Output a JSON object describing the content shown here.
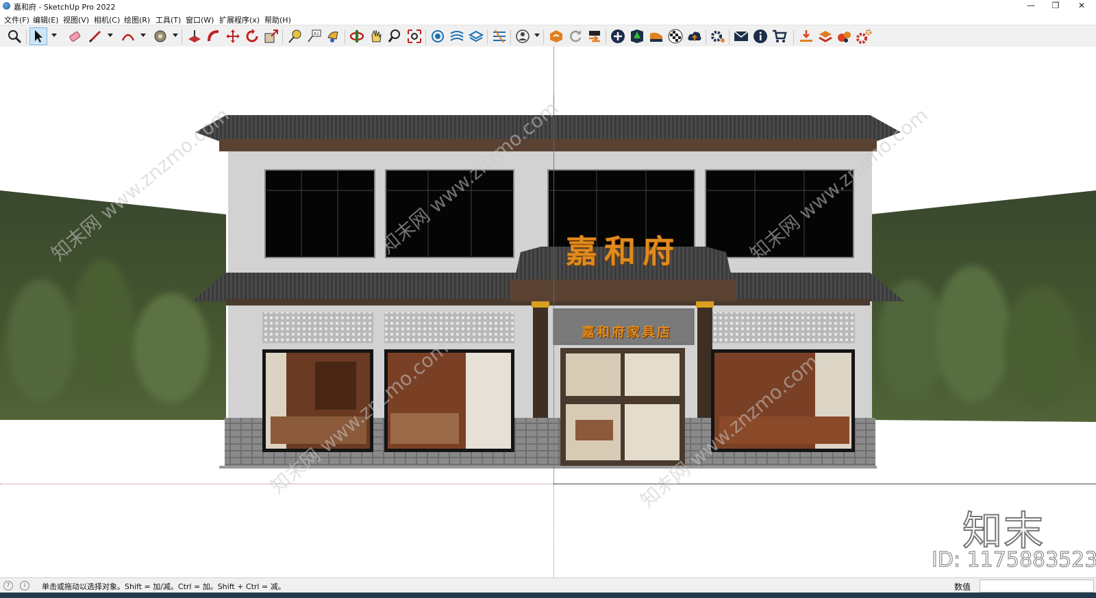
{
  "window": {
    "title": "嘉和府 - SketchUp Pro 2022",
    "controls": {
      "minimize": "—",
      "restore": "❐",
      "close": "✕"
    }
  },
  "menu": [
    "文件(F)",
    "编辑(E)",
    "视图(V)",
    "相机(C)",
    "绘图(R)",
    "工具(T)",
    "窗口(W)",
    "扩展程序(x)",
    "帮助(H)"
  ],
  "toolbar": {
    "tools": [
      "zoom-icon",
      "select-arrow-icon",
      "eraser-icon",
      "pencil-line-icon",
      "arc-icon",
      "paint-bucket-icon",
      "push-pull-icon",
      "follow-me-icon",
      "move-icon",
      "rotate-icon",
      "scale-icon",
      "tape-measure-icon",
      "text-label-icon",
      "paint-icon",
      "orbit-icon",
      "pan-icon",
      "zoom-window-icon",
      "zoom-extents-icon",
      "sandbox-icon",
      "smoove-icon",
      "stamp-icon",
      "drape-icon",
      "user-icon",
      "extension-warehouse-icon",
      "refresh-icon",
      "export-icon",
      "add-circle-icon",
      "tree-icon",
      "layers-icon",
      "checker-icon",
      "cloud-upload-icon",
      "settings-icon",
      "mail-icon",
      "info-icon",
      "cart-icon",
      "download-tray-icon",
      "stack-icon",
      "render-icon",
      "gear-orange-icon"
    ]
  },
  "scene": {
    "sign_main": "嘉和府",
    "sign_shop": "嘉和府家具店",
    "watermark": "知末网 www.znzmo.com",
    "logo": "知末",
    "id_label": "ID: 1175883523"
  },
  "status": {
    "text": "单击或拖动以选择对象。Shift = 加/减。Ctrl = 加。Shift + Ctrl = 减。",
    "measurements_label": "数值",
    "measurements_value": ""
  },
  "colors": {
    "roof": "#3d3d3d",
    "wall": "#cfcfcf",
    "wood": "#4a3a2e",
    "sign_gold": "#e08a1e",
    "hill": "#3c4d2f",
    "toolbar_bg": "#f0f0f0"
  }
}
